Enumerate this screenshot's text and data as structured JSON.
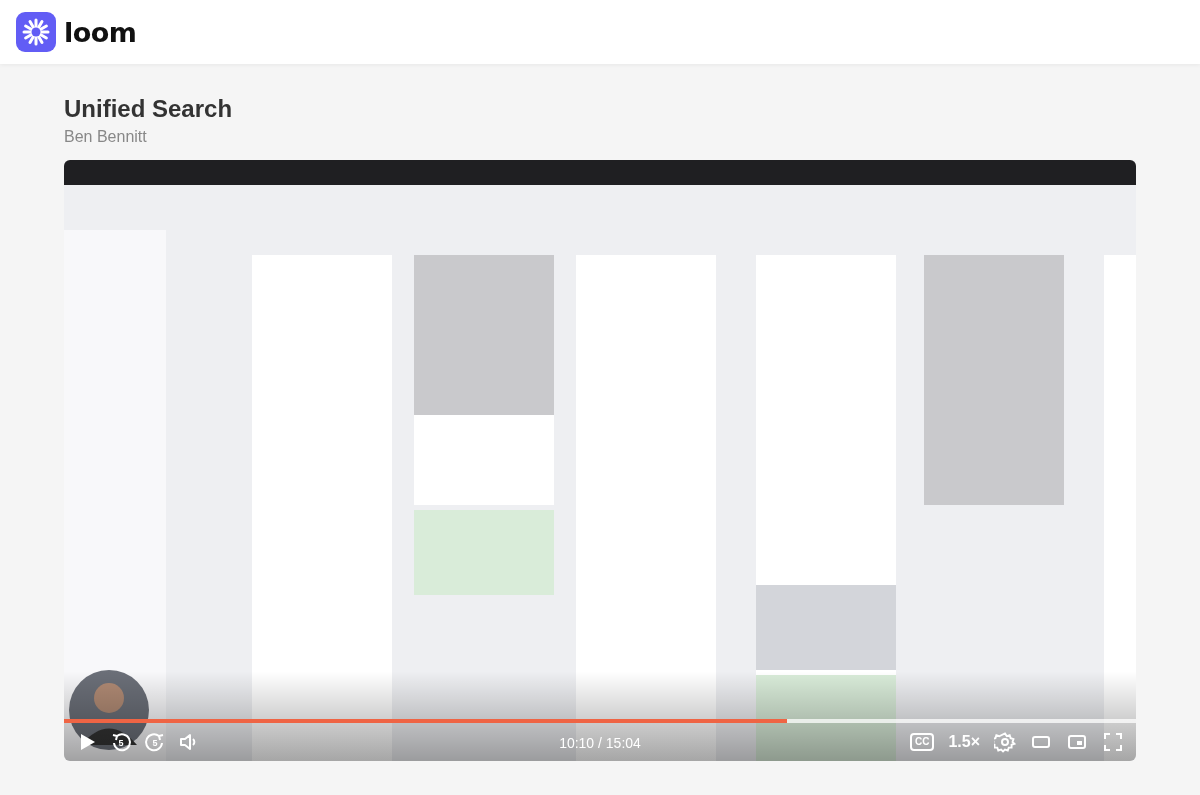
{
  "header": {
    "brand": "loom"
  },
  "video": {
    "title": "Unified Search",
    "author": "Ben Bennitt",
    "progress": {
      "level": 0.674
    },
    "time": "10:10 / 15:04",
    "rewind_seconds": "5",
    "forward_seconds": "5",
    "captions_label": "CC",
    "speed": "1.5×",
    "playing": false
  }
}
